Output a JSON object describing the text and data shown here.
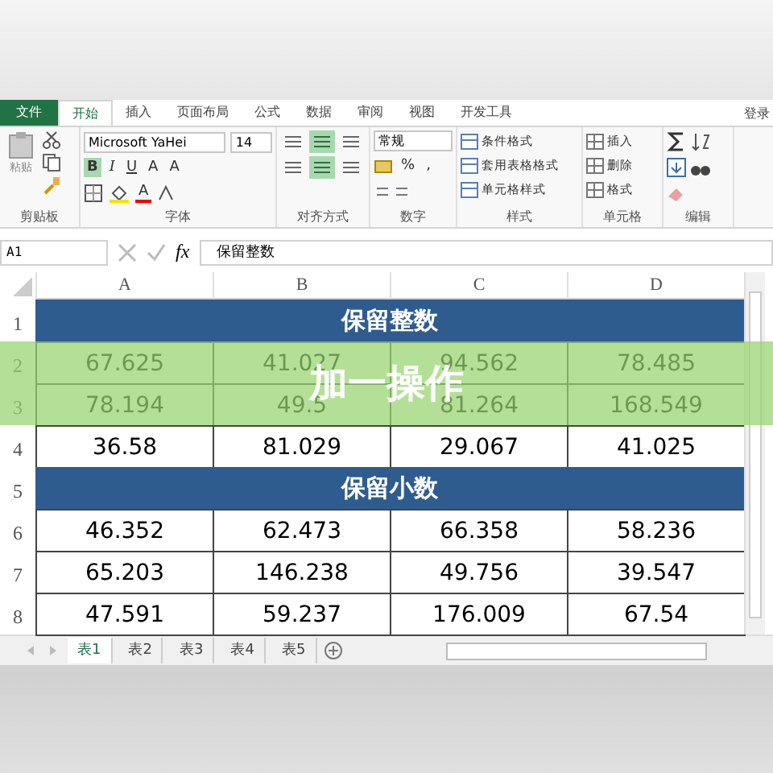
{
  "menu_tabs": [
    {
      "label": "文件",
      "kind": "file",
      "selected": false
    },
    {
      "label": "开始",
      "kind": "tab",
      "selected": true
    },
    {
      "label": "插入",
      "kind": "tab",
      "selected": false
    },
    {
      "label": "页面布局",
      "kind": "tab",
      "selected": false
    },
    {
      "label": "公式",
      "kind": "tab",
      "selected": false
    },
    {
      "label": "数据",
      "kind": "tab",
      "selected": false
    },
    {
      "label": "审阅",
      "kind": "tab",
      "selected": false
    },
    {
      "label": "视图",
      "kind": "tab",
      "selected": false
    },
    {
      "label": "开发工具",
      "kind": "tab",
      "selected": false
    }
  ],
  "account": "登录",
  "ribbon": {
    "paste_label": "粘贴",
    "font_name": "Microsoft YaHei",
    "font_size": "14",
    "font_buttons": [
      {
        "label": "B",
        "selected": true
      },
      {
        "label": "I",
        "selected": false
      },
      {
        "label": "U",
        "selected": false
      }
    ],
    "grow_labels": [
      "A",
      "A"
    ],
    "font_color_label": "A",
    "align_buttons": [
      {
        "selected": false
      },
      {
        "selected": true
      },
      {
        "selected": false
      },
      {
        "selected": false
      },
      {
        "selected": true
      },
      {
        "selected": false
      }
    ],
    "number_format": "常规",
    "number_buttons": [
      "%",
      ","
    ],
    "styles": [
      "条件格式",
      "套用表格格式",
      "单元格样式"
    ],
    "cells": [
      "插入",
      "删除",
      "格式"
    ],
    "groups": [
      "剪贴板",
      "字体",
      "对齐方式",
      "数字",
      "样式",
      "单元格",
      "编辑"
    ]
  },
  "formula_bar": {
    "name_box": "A1",
    "fx": "fx",
    "content": "保留整数"
  },
  "columns": [
    "A",
    "B",
    "C",
    "D"
  ],
  "rows": [
    {
      "number": "1",
      "kind": "header",
      "text": "保留整数"
    },
    {
      "number": "2",
      "kind": "values",
      "cells": [
        "67.625",
        "41.027",
        "94.562",
        "78.485"
      ]
    },
    {
      "number": "3",
      "kind": "values",
      "cells": [
        "78.194",
        "49.5",
        "81.264",
        "168.549"
      ]
    },
    {
      "number": "4",
      "kind": "values",
      "cells": [
        "36.58",
        "81.029",
        "29.067",
        "41.025"
      ]
    },
    {
      "number": "5",
      "kind": "header",
      "text": "保留小数"
    },
    {
      "number": "6",
      "kind": "values",
      "cells": [
        "46.352",
        "62.473",
        "66.358",
        "58.236"
      ]
    },
    {
      "number": "7",
      "kind": "values",
      "cells": [
        "65.203",
        "146.238",
        "49.756",
        "39.547"
      ]
    },
    {
      "number": "8",
      "kind": "values",
      "cells": [
        "47.591",
        "59.237",
        "176.009",
        "67.54"
      ]
    }
  ],
  "overlay": {
    "text": "加一操作"
  },
  "sheet_tabs": [
    {
      "label": "表1",
      "selected": true
    },
    {
      "label": "表2",
      "selected": false
    },
    {
      "label": "表3",
      "selected": false
    },
    {
      "label": "表4",
      "selected": false
    },
    {
      "label": "表5",
      "selected": false
    }
  ]
}
